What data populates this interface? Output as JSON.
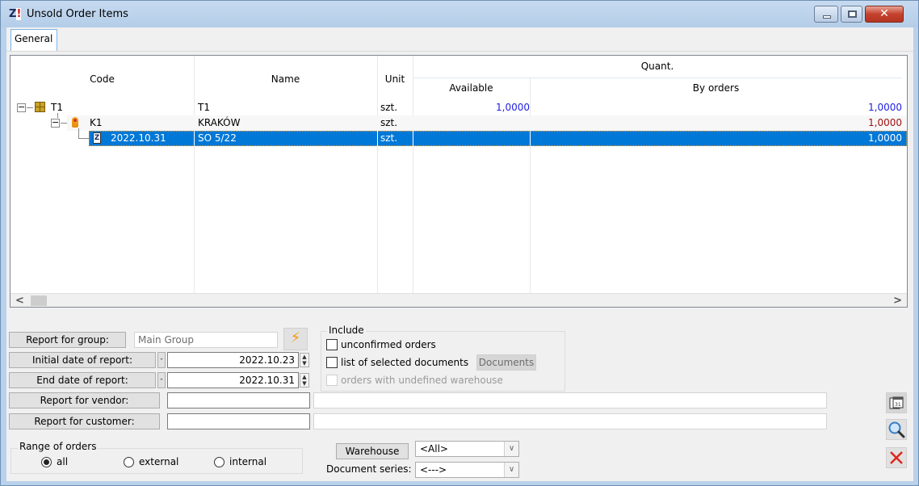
{
  "window": {
    "title": "Unsold Order Items",
    "app_icon": "app-logo-icon",
    "controls": {
      "minimize": "minimize-icon",
      "maximize": "maximize-icon",
      "close": "close-icon"
    }
  },
  "tabs": [
    {
      "label": "General",
      "active": true
    }
  ],
  "grid": {
    "columns": {
      "code": "Code",
      "name": "Name",
      "unit": "Unit",
      "quant_group": "Quant.",
      "available": "Available",
      "by_orders": "By orders"
    },
    "rows": [
      {
        "level": 0,
        "icon": "product-icon",
        "expanded": true,
        "code": "T1",
        "name": "T1",
        "unit": "szt.",
        "available": "1,0000",
        "by_orders": "1,0000",
        "color": "#1f1fe0",
        "selected": false
      },
      {
        "level": 1,
        "icon": "customer-icon",
        "expanded": true,
        "code": "K1",
        "name": "KRAKÓW",
        "unit": "szt.",
        "available": "",
        "by_orders": "1,0000",
        "color": "#a01010",
        "selected": false
      },
      {
        "level": 2,
        "icon": "document-icon",
        "code": "2022.10.31",
        "name": "SO 5/22",
        "unit": "szt.",
        "available": "",
        "by_orders": "1,0000",
        "color": "#ffffff",
        "selected": true
      }
    ],
    "scrollbar": {
      "left_arrow": "<",
      "right_arrow": ">"
    }
  },
  "filters": {
    "group": {
      "button": "Report for group:",
      "value": "Main Group"
    },
    "initial_date": {
      "button": "Initial date of report:",
      "value": "2022.10.23"
    },
    "end_date": {
      "button": "End date of report:",
      "value": "2022.10.31"
    },
    "vendor": {
      "button": "Report for vendor:",
      "code": "",
      "name": ""
    },
    "customer": {
      "button": "Report for customer:",
      "code": "",
      "name": ""
    },
    "minus_label": "-"
  },
  "include": {
    "title": "Include",
    "unconfirmed_orders": {
      "label": "unconfirmed orders",
      "checked": false
    },
    "selected_documents": {
      "label": "list of selected documents",
      "checked": false
    },
    "documents_button": "Documents",
    "undefined_warehouse": {
      "label": "orders with undefined warehouse",
      "checked": false,
      "disabled": true
    }
  },
  "range": {
    "title": "Range of orders",
    "options": [
      {
        "label": "all",
        "selected": true
      },
      {
        "label": "external",
        "selected": false
      },
      {
        "label": "internal",
        "selected": false
      }
    ]
  },
  "warehouse": {
    "button": "Warehouse",
    "value": "<All>"
  },
  "document_series": {
    "label": "Document series:",
    "value": "<--->"
  },
  "side_buttons": {
    "calendar": "calendar-icon",
    "search": "search-icon",
    "cancel": "cancel-icon"
  }
}
